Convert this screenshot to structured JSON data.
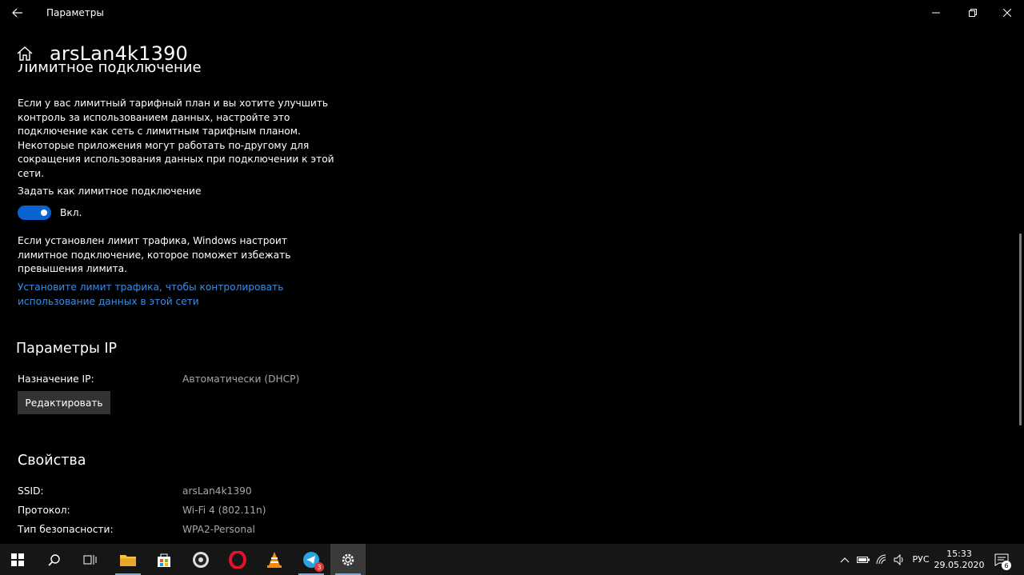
{
  "window": {
    "app_title": "Параметры",
    "page_title": "arsLan4k1390"
  },
  "metered": {
    "heading": "Лимитное подключение",
    "description": "Если у вас лимитный тарифный план и вы хотите улучшить контроль за использованием данных, настройте это подключение как сеть с лимитным тарифным планом. Некоторые приложения могут работать по-другому для сокращения использования данных при подключении к этой сети.",
    "set_label": "Задать как лимитное подключение",
    "toggle_state": "Вкл.",
    "toggle_on": true,
    "limit_info": "Если установлен лимит трафика, Windows настроит лимитное подключение, которое поможет избежать превышения лимита.",
    "link": "Установите лимит трафика, чтобы контролировать использование данных в этой сети"
  },
  "ip": {
    "heading": "Параметры IP",
    "assignment_label": "Назначение IP:",
    "assignment_value": "Автоматически (DHCP)",
    "edit_button": "Редактировать"
  },
  "properties": {
    "heading": "Свойства",
    "rows": [
      {
        "label": "SSID:",
        "value": "arsLan4k1390"
      },
      {
        "label": "Протокол:",
        "value": "Wi-Fi 4 (802.11n)"
      },
      {
        "label": "Тип безопасности:",
        "value": "WPA2-Personal"
      }
    ]
  },
  "taskbar": {
    "language": "РУС",
    "time": "15:33",
    "date": "29.05.2020",
    "telegram_badge": "3",
    "notifications_count": "6"
  },
  "colors": {
    "accent": "#0a63d1",
    "link": "#3a8ee6",
    "background": "#000000",
    "taskbar": "#161616"
  }
}
